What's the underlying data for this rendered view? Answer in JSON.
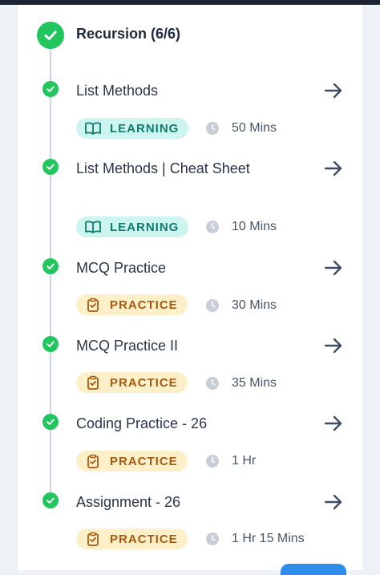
{
  "section": {
    "title": "Recursion (6/6)"
  },
  "items": [
    {
      "title": "List Methods",
      "badge": "LEARNING",
      "badge_type": "learning",
      "duration": "50 Mins"
    },
    {
      "title": "List Methods | Cheat Sheet",
      "badge": "LEARNING",
      "badge_type": "learning",
      "duration": "10 Mins"
    },
    {
      "title": "MCQ Practice",
      "badge": "PRACTICE",
      "badge_type": "practice",
      "duration": "30 Mins"
    },
    {
      "title": "MCQ Practice II",
      "badge": "PRACTICE",
      "badge_type": "practice",
      "duration": "35 Mins"
    },
    {
      "title": "Coding Practice - 26",
      "badge": "PRACTICE",
      "badge_type": "practice",
      "duration": "1 Hr"
    },
    {
      "title": "Assignment - 26",
      "badge": "PRACTICE",
      "badge_type": "practice",
      "duration": "1 Hr 15 Mins"
    }
  ],
  "colors": {
    "complete": "#22c55e",
    "learning_bg": "#cdf5ef",
    "learning_text": "#127a6d",
    "practice_bg": "#fdf0c8",
    "practice_text": "#a55a12",
    "accent": "#2f8dea"
  },
  "icons": {
    "section_status": "check-circle-icon",
    "item_status": "check-circle-icon",
    "learning": "book-open-icon",
    "practice": "clipboard-check-icon",
    "time": "clock-icon",
    "navigate": "arrow-right-icon"
  }
}
